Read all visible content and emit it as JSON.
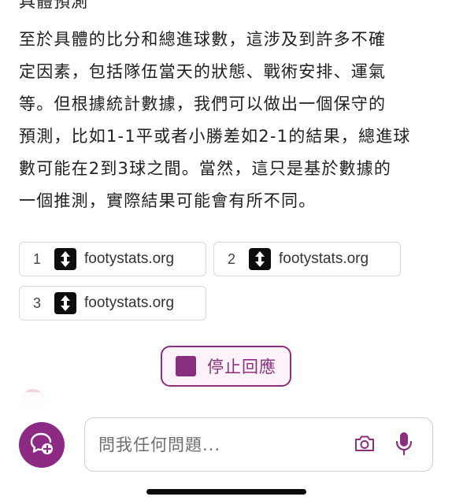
{
  "answer": {
    "cutoff_heading": "具體預測",
    "lines": [
      "至於具體的比分和總進球數，這涉及到許多不確",
      "定因素，包括隊伍當天的狀態、戰術安排、運氣",
      "等。但根據統計數據，我們可以做出一個保守的",
      "預測，比如1-1平或者小勝差如2-1的結果，總進球",
      "數可能在2到3球之間。當然，這只是基於數據的",
      "一個推測，實際結果可能會有所不同。"
    ]
  },
  "sources": [
    {
      "num": "1",
      "site": "footystats.org",
      "icon": "footystats-logo-icon"
    },
    {
      "num": "2",
      "site": "footystats.org",
      "icon": "footystats-logo-icon"
    },
    {
      "num": "3",
      "site": "footystats.org",
      "icon": "footystats-logo-icon"
    }
  ],
  "stop_button": {
    "label": "停止回應"
  },
  "composer": {
    "placeholder": "問我任何問題...",
    "new_chat_icon": "chat-plus-icon",
    "camera_icon": "camera-icon",
    "mic_icon": "microphone-icon"
  },
  "colors": {
    "accent": "#8a2f7e",
    "accent_bg": "#fbf3f9",
    "chip_border": "#d8d8d8",
    "text": "#1f1f1f"
  }
}
